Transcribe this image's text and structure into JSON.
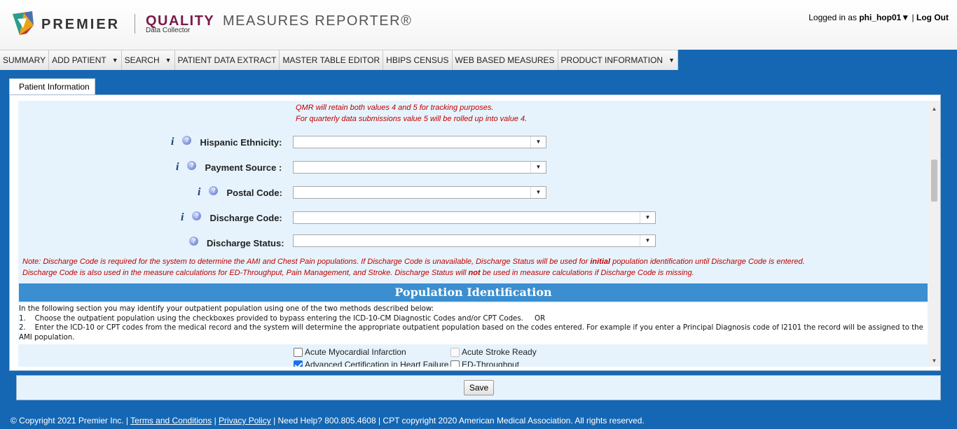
{
  "header": {
    "brand": "PREMIER",
    "product_quality": "QUALITY",
    "product_rest": "MEASURES REPORTER®",
    "product_sub": "Data Collector",
    "login_prefix": "Logged in as",
    "username": "phi_hop01▼",
    "separator": "|",
    "logout": "Log Out"
  },
  "nav": {
    "items": [
      {
        "label": "SUMMARY",
        "dropdown": false
      },
      {
        "label": "ADD PATIENT",
        "dropdown": true
      },
      {
        "label": "SEARCH",
        "dropdown": true
      },
      {
        "label": "PATIENT DATA EXTRACT",
        "dropdown": false
      },
      {
        "label": "MASTER TABLE EDITOR",
        "dropdown": false
      },
      {
        "label": "HBIPS CENSUS",
        "dropdown": false
      },
      {
        "label": "WEB BASED MEASURES",
        "dropdown": false
      },
      {
        "label": "PRODUCT INFORMATION",
        "dropdown": true
      }
    ]
  },
  "tab": {
    "label": "Patient Information"
  },
  "form": {
    "qmr_note_line1": "QMR will retain both values 4 and 5 for tracking purposes.",
    "qmr_note_line2": "For quarterly data submissions value 5 will be rolled up into value 4.",
    "fields": {
      "hispanic": {
        "label": "Hispanic Ethnicity:",
        "value": ""
      },
      "payment": {
        "label": "Payment Source :",
        "value": ""
      },
      "postal": {
        "label": "Postal Code:",
        "value": ""
      },
      "discharge_code": {
        "label": "Discharge Code:",
        "value": ""
      },
      "discharge_status": {
        "label": "Discharge Status:",
        "value": ""
      }
    },
    "note_line1_a": "Note: Discharge Code is required for the system to determine the AMI and Chest Pain populations. If Discharge Code is unavailable, Discharge Status will be used for ",
    "note_line1_b": "initial",
    "note_line1_c": " population identification until Discharge Code is entered.",
    "note_line2_a": "Discharge Code is also used in the measure calculations for ED-Throughput, Pain Management, and Stroke. Discharge Status will ",
    "note_line2_b": "not",
    "note_line2_c": " be used in measure calculations if Discharge Code is missing."
  },
  "population": {
    "title": "Population Identification",
    "intro": "In the following section you may identify your outpatient population using one of the two methods described below:",
    "method1": "1.    Choose the outpatient population using the checkboxes provided to bypass entering the ICD-10-CM Diagnostic Codes and/or CPT Codes.     OR",
    "method2": "2.    Enter the ICD-10 or CPT codes from the medical record and the system will determine the appropriate outpatient population based on the codes entered. For example if you enter a Principal Diagnosis code of I2101 the record will be assigned to the AMI population.",
    "checkboxes": {
      "ami": {
        "label": "Acute Myocardial Infarction",
        "checked": false
      },
      "stroke_ready": {
        "label": "Acute Stroke Ready",
        "checked": false,
        "disabled": true
      },
      "heart_failure": {
        "label": "Advanced Certification in Heart Failure",
        "checked": true
      },
      "ed_throughput": {
        "label": "ED-Throughput",
        "checked": false
      }
    }
  },
  "actions": {
    "save_label": "Save"
  },
  "footer": {
    "copyright": "© Copyright 2021 Premier Inc.  |",
    "terms": "Terms and Conditions",
    "sep1": "|",
    "privacy": "Privacy Policy",
    "rest": "| Need Help? 800.805.4608 | CPT copyright 2020 American Medical Association. All rights reserved."
  },
  "colors": {
    "page_bg": "#1567b3",
    "form_bg": "#e6f3fc",
    "section_header": "#3b8ecf",
    "note_red": "#c00000",
    "brand_quality": "#7a1a4a"
  }
}
